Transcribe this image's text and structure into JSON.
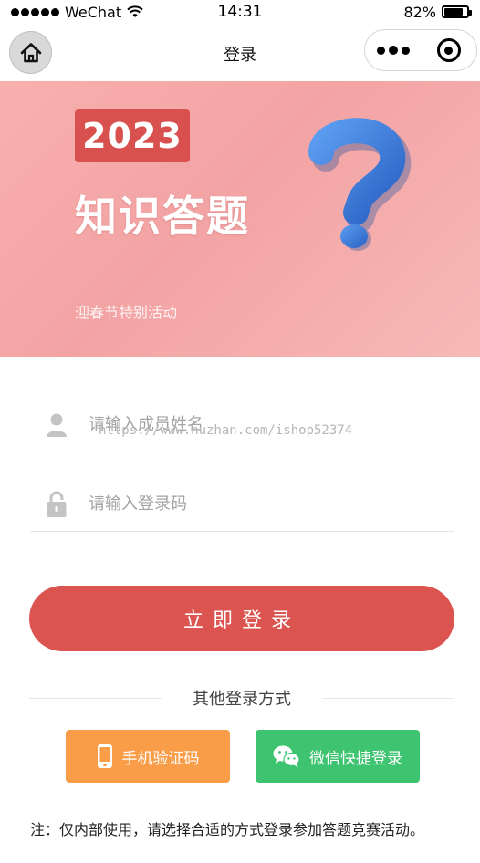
{
  "status_bar": {
    "carrier": "WeChat",
    "time": "14:31",
    "battery_percent_label": "82%",
    "battery_level": 0.82
  },
  "nav": {
    "title": "登录"
  },
  "banner": {
    "year": "2023",
    "title": "知识答题",
    "subtitle": "迎春节特别活动"
  },
  "form": {
    "name_placeholder": "请输入成员姓名",
    "code_placeholder": "请输入登录码",
    "watermark": "https://www.huzhan.com/ishop52374"
  },
  "login_button": {
    "label": "立即登录"
  },
  "other_login": {
    "heading": "其他登录方式",
    "phone_label": "手机验证码",
    "wechat_label": "微信快捷登录"
  },
  "note": "注：仅内部使用，请选择合适的方式登录参加答题竞赛活动。",
  "colors": {
    "primary_red": "#db5450",
    "phone_orange": "#fa9d48",
    "wechat_green": "#3ec470",
    "banner_pink": "#f3a3a4",
    "question_blue": "#3f7fd8"
  },
  "icons": {
    "home": "home-icon",
    "more": "more-dots-icon",
    "close": "target-close-icon",
    "user": "user-icon",
    "lock": "lock-icon",
    "phone": "mobile-phone-icon",
    "wechat": "wechat-icon",
    "question": "question-mark-icon"
  }
}
